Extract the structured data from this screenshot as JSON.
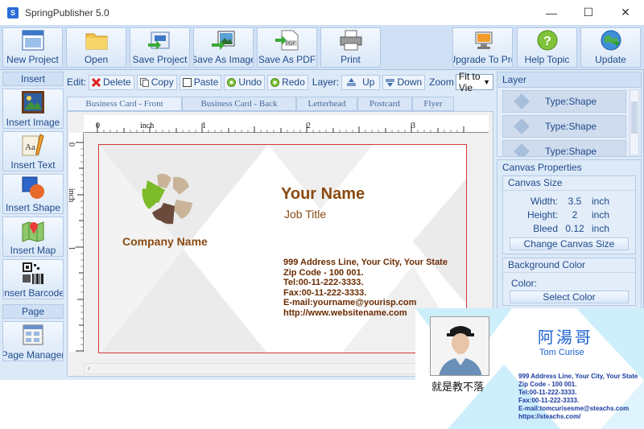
{
  "window": {
    "title": "SpringPublisher 5.0",
    "minimize": "—",
    "maximize": "☐",
    "close": "✕"
  },
  "toolbar": {
    "buttons": [
      "New Project",
      "Open",
      "Save Project",
      "Save As Image",
      "Save As PDF",
      "Print",
      "Upgrade To Pro",
      "Help Topic",
      "Update"
    ],
    "pdf_badge": "PDF"
  },
  "left": {
    "insert_header": "Insert",
    "insert_items": [
      "Insert Image",
      "Insert Text",
      "Insert Shape",
      "Insert Map",
      "Insert Barcode"
    ],
    "text_icon_glyph": "Aa",
    "page_header": "Page",
    "page_items": [
      "Page Manager"
    ]
  },
  "editbar": {
    "edit_label": "Edit:",
    "delete": "Delete",
    "copy": "Copy",
    "paste": "Paste",
    "undo": "Undo",
    "redo": "Redo",
    "layer_label": "Layer:",
    "up": "Up",
    "down": "Down",
    "zoom_label": "Zoom",
    "zoom_value": "Fit to Vie"
  },
  "tabs": [
    "Business Card - Front",
    "Business Card - Back",
    "Letterhead",
    "Postcard",
    "Flyer"
  ],
  "ruler": {
    "unit": "inch",
    "h_numbers": [
      "0",
      "1",
      "2",
      "3"
    ],
    "v_numbers": [
      "0",
      "1"
    ],
    "v_unit": "inch"
  },
  "card": {
    "company": "Company Name",
    "name": "Your Name",
    "job_title": "Job Title",
    "address": "999 Address Line, Your City, Your State",
    "zip": "Zip Code - 100 001.",
    "tel": "Tel:00-11-222-3333.",
    "fax": "Fax:00-11-222-3333.",
    "email": "E-mail:yourname@yourisp.com",
    "web": "http://www.websitename.com",
    "colors": {
      "name": "#8a4a12",
      "logo_green": "#7dbb2a",
      "logo_tan": "#c9b49a",
      "logo_brown": "#6a4a3a",
      "address": "#6b2a00"
    }
  },
  "right": {
    "layer_header": "Layer",
    "layers": [
      "Type:Shape",
      "Type:Shape",
      "Type:Shape"
    ],
    "canvas_props_title": "Canvas Properties",
    "canvas_size_title": "Canvas Size",
    "width_label": "Width:",
    "width_value": "3.5",
    "width_unit": "inch",
    "height_label": "Height:",
    "height_value": "2",
    "height_unit": "inch",
    "bleed_label": "Bleed",
    "bleed_value": "0.12",
    "bleed_unit": "inch",
    "change_size_btn": "Change Canvas Size",
    "bg_color_title": "Background Color",
    "color_label": "Color:",
    "select_color_btn": "Select Color"
  },
  "overlay": {
    "chinese_name": "阿湯哥",
    "english_name": "Tom Curise",
    "slogan": "就是教不落",
    "address": "999 Address Line, Your City, Your State",
    "zip": "Zip Code - 100 001.",
    "tel": "Tel:00-11-222-3333.",
    "fax": "Fax:00-11-222-3333.",
    "email": "E-mail:tomcurisesme@steachs.com",
    "web": "https://steachs.com/",
    "colors": {
      "name": "#1a5fd0",
      "text": "#1a3aa0",
      "bg_tint": "#cdeefb"
    }
  }
}
